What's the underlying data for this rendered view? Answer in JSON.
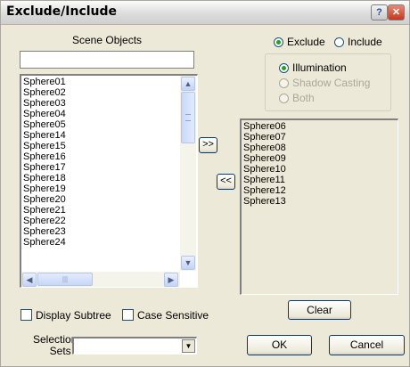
{
  "window": {
    "title": "Exclude/Include",
    "help_icon": "question-mark-icon",
    "close_icon": "close-x-icon"
  },
  "scene_objects": {
    "heading": "Scene Objects",
    "filter_value": "",
    "items": [
      "Sphere01",
      "Sphere02",
      "Sphere03",
      "Sphere04",
      "Sphere05",
      "Sphere14",
      "Sphere15",
      "Sphere16",
      "Sphere17",
      "Sphere18",
      "Sphere19",
      "Sphere20",
      "Sphere21",
      "Sphere22",
      "Sphere23",
      "Sphere24"
    ]
  },
  "transfer": {
    "add_label": ">>",
    "remove_label": "<<"
  },
  "mode": {
    "exclude_label": "Exclude",
    "include_label": "Include",
    "selected": "Exclude"
  },
  "affect": {
    "illumination_label": "Illumination",
    "shadow_label": "Shadow Casting",
    "both_label": "Both",
    "selected": "Illumination"
  },
  "excluded": {
    "items": [
      "Sphere06",
      "Sphere07",
      "Sphere08",
      "Sphere09",
      "Sphere10",
      "Sphere11",
      "Sphere12",
      "Sphere13"
    ]
  },
  "options": {
    "display_subtree_label": "Display Subtree",
    "case_sensitive_label": "Case Sensitive",
    "display_subtree_checked": false,
    "case_sensitive_checked": false
  },
  "selection_sets": {
    "label_line1": "Selection",
    "label_line2": "Sets",
    "value": ""
  },
  "buttons": {
    "clear": "Clear",
    "ok": "OK",
    "cancel": "Cancel"
  }
}
